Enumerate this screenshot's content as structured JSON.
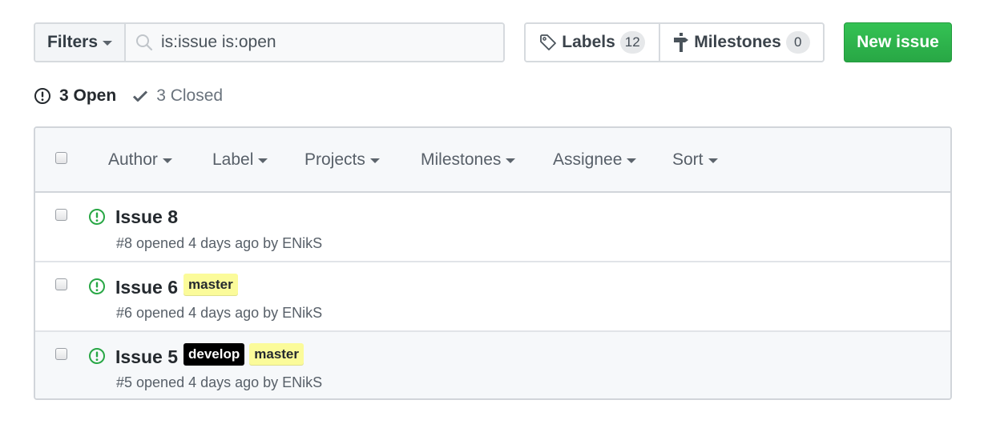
{
  "toolbar": {
    "filters_label": "Filters",
    "search_value": "is:issue is:open",
    "labels_label": "Labels",
    "labels_count": "12",
    "milestones_label": "Milestones",
    "milestones_count": "0",
    "new_issue_label": "New issue"
  },
  "states": {
    "open_label": "3 Open",
    "closed_label": "3 Closed"
  },
  "header_filters": [
    {
      "label": "Author"
    },
    {
      "label": "Label"
    },
    {
      "label": "Projects"
    },
    {
      "label": "Milestones"
    },
    {
      "label": "Assignee"
    },
    {
      "label": "Sort"
    }
  ],
  "issues": [
    {
      "title": "Issue 8",
      "meta_prefix": "#8 opened 4 days ago by ",
      "author": "ENikS",
      "labels": []
    },
    {
      "title": "Issue 6",
      "meta_prefix": "#6 opened 4 days ago by ",
      "author": "ENikS",
      "labels": [
        {
          "name": "master",
          "bg": "#fbfb9a",
          "fg": "#24292e"
        }
      ]
    },
    {
      "title": "Issue 5",
      "meta_prefix": "#5 opened 4 days ago by ",
      "author": "ENikS",
      "labels": [
        {
          "name": "develop",
          "bg": "#000000",
          "fg": "#ffffff"
        },
        {
          "name": "master",
          "bg": "#fbfb9a",
          "fg": "#24292e"
        }
      ]
    }
  ],
  "colors": {
    "open_icon": "#28a745",
    "primary_button": "#2cbe4e",
    "label_master": "#fbfb9a",
    "label_develop": "#000000"
  }
}
